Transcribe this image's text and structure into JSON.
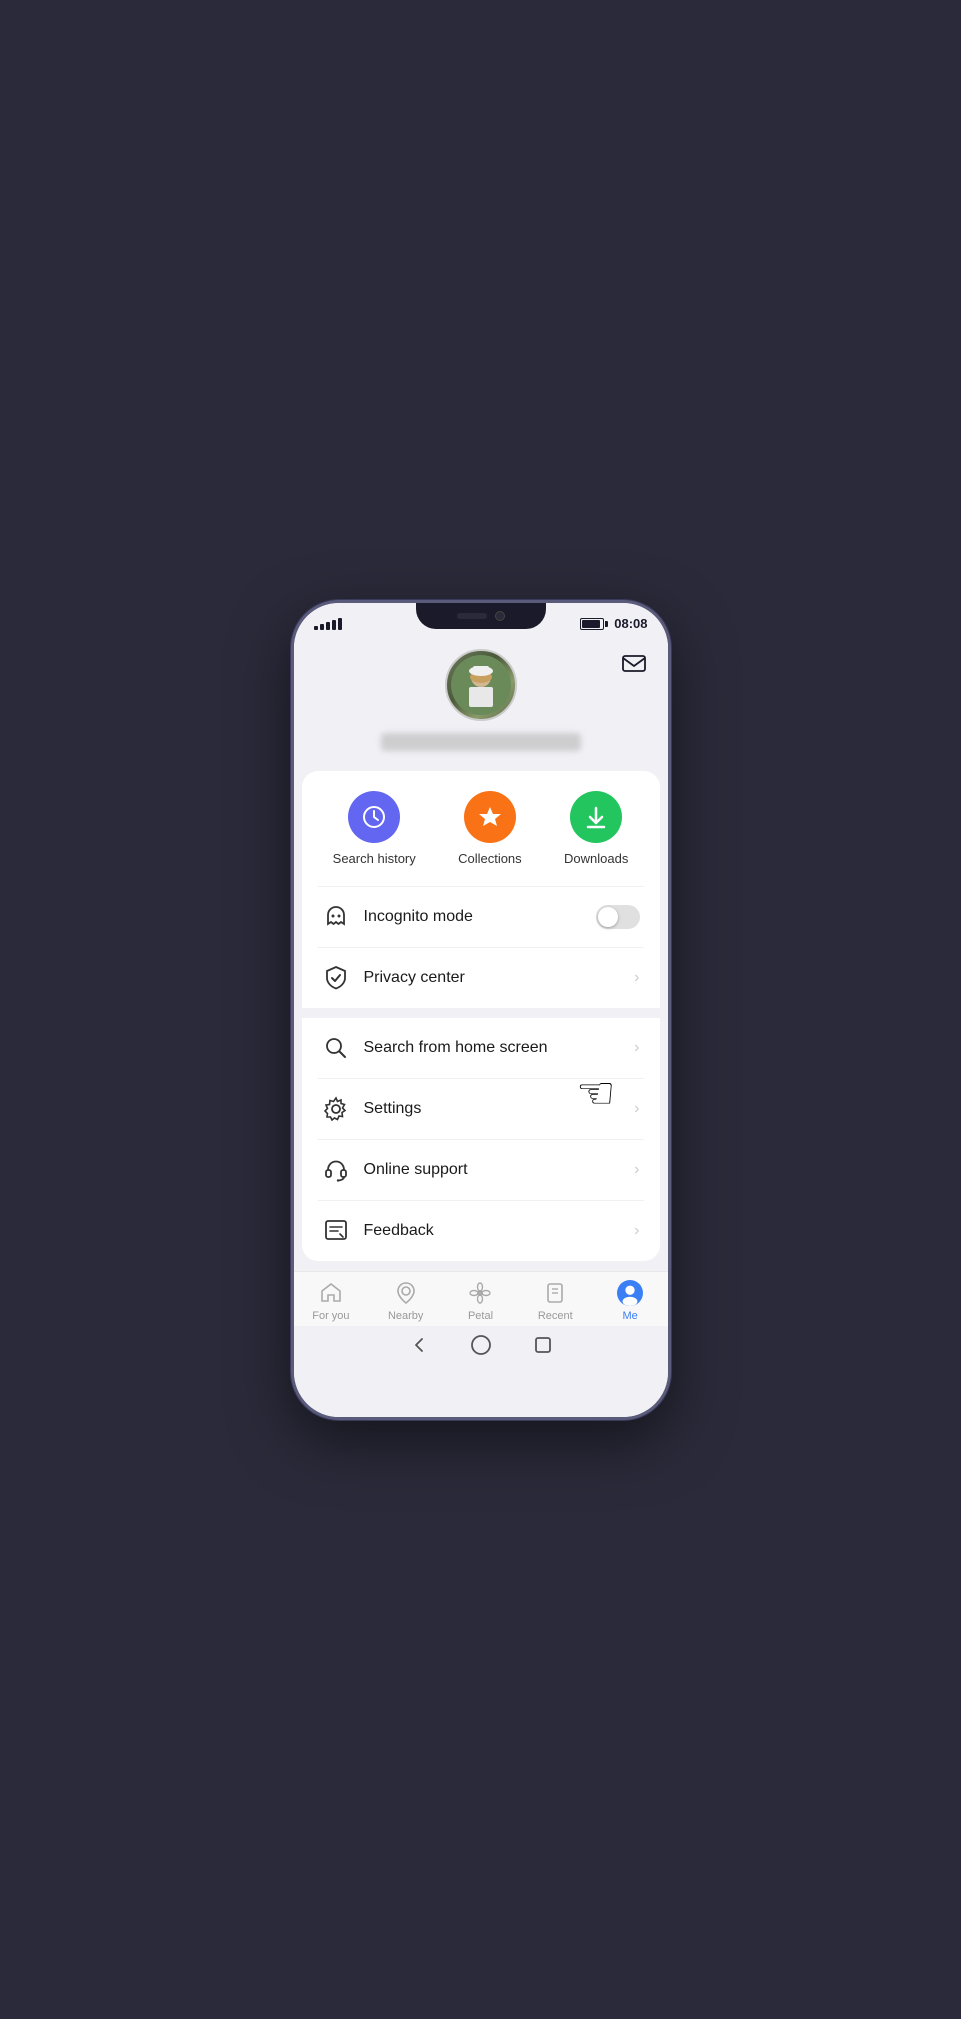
{
  "status": {
    "time": "08:08",
    "signal_bars": [
      4,
      6,
      8,
      10,
      12
    ],
    "battery_pct": 90
  },
  "header": {
    "mail_icon": "mail-icon"
  },
  "quick_actions": [
    {
      "id": "search-history",
      "label": "Search history",
      "icon_type": "clock",
      "bg": "history"
    },
    {
      "id": "collections",
      "label": "Collections",
      "icon_type": "star",
      "bg": "collections"
    },
    {
      "id": "downloads",
      "label": "Downloads",
      "icon_type": "download",
      "bg": "downloads"
    }
  ],
  "menu_items": [
    {
      "id": "incognito-mode",
      "label": "Incognito mode",
      "icon": "ghost",
      "type": "toggle",
      "toggle_on": false
    },
    {
      "id": "privacy-center",
      "label": "Privacy center",
      "icon": "shield-check",
      "type": "arrow"
    },
    {
      "id": "search-home",
      "label": "Search from home screen",
      "icon": "search",
      "type": "arrow"
    },
    {
      "id": "settings",
      "label": "Settings",
      "icon": "gear",
      "type": "arrow"
    },
    {
      "id": "online-support",
      "label": "Online support",
      "icon": "headset",
      "type": "arrow"
    },
    {
      "id": "feedback",
      "label": "Feedback",
      "icon": "feedback",
      "type": "arrow"
    }
  ],
  "bottom_nav": [
    {
      "id": "for-you",
      "label": "For you",
      "active": false
    },
    {
      "id": "nearby",
      "label": "Nearby",
      "active": false
    },
    {
      "id": "petal",
      "label": "Petal",
      "active": false
    },
    {
      "id": "recent",
      "label": "Recent",
      "active": false
    },
    {
      "id": "me",
      "label": "Me",
      "active": true
    }
  ],
  "system_nav": {
    "back_label": "◁",
    "home_label": "○",
    "recent_label": "□"
  }
}
